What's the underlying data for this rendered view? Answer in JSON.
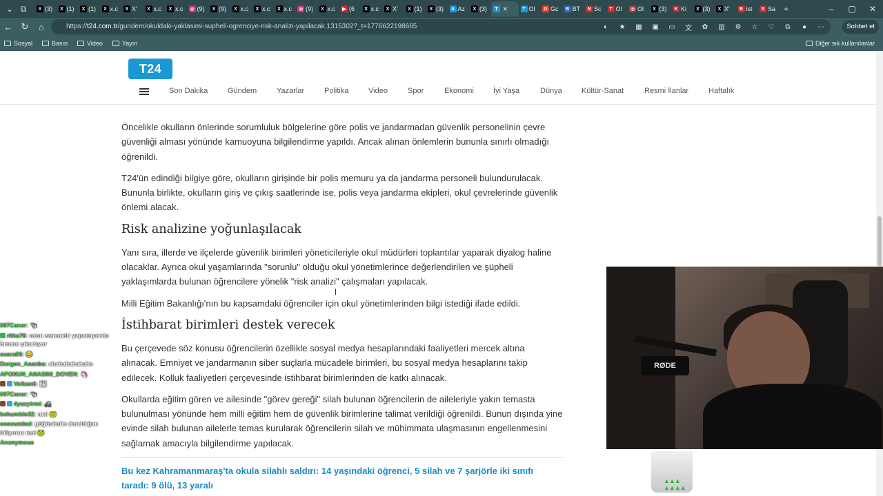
{
  "browser": {
    "tabs": [
      {
        "icon": "X",
        "label": "(3)",
        "color": "#000"
      },
      {
        "icon": "X",
        "label": "(1)",
        "color": "#000"
      },
      {
        "icon": "X",
        "label": "(1)",
        "color": "#000"
      },
      {
        "icon": "X",
        "label": "x.c",
        "color": "#000"
      },
      {
        "icon": "X",
        "label": "X'",
        "color": "#000"
      },
      {
        "icon": "X",
        "label": "x.c",
        "color": "#000"
      },
      {
        "icon": "X",
        "label": "x.c",
        "color": "#000"
      },
      {
        "icon": "◎",
        "label": "(9)",
        "color": "#d62976"
      },
      {
        "icon": "X",
        "label": "(9)",
        "color": "#000"
      },
      {
        "icon": "X",
        "label": "x.c",
        "color": "#000"
      },
      {
        "icon": "X",
        "label": "x.c",
        "color": "#000"
      },
      {
        "icon": "X",
        "label": "x.c",
        "color": "#000"
      },
      {
        "icon": "◎",
        "label": "(9)",
        "color": "#d62976"
      },
      {
        "icon": "X",
        "label": "x.c",
        "color": "#000"
      },
      {
        "icon": "▶",
        "label": "(6",
        "color": "#e02020"
      },
      {
        "icon": "X",
        "label": "x.c",
        "color": "#000"
      },
      {
        "icon": "X",
        "label": "X'",
        "color": "#000"
      },
      {
        "icon": "X",
        "label": "(1)",
        "color": "#000"
      },
      {
        "icon": "X",
        "label": "(3)",
        "color": "#000"
      },
      {
        "icon": "A",
        "label": "Az",
        "color": "#1a98d5"
      },
      {
        "icon": "X",
        "label": "(3)",
        "color": "#000"
      },
      {
        "icon": "T",
        "label": "",
        "color": "#1a98d5",
        "active": true
      },
      {
        "icon": "T",
        "label": "Ol",
        "color": "#1a98d5"
      },
      {
        "icon": "G",
        "label": "Gc",
        "color": "#e04030"
      },
      {
        "icon": "B",
        "label": "BT",
        "color": "#2b6cb0"
      },
      {
        "icon": "N",
        "label": "Sc",
        "color": "#c03030"
      },
      {
        "icon": "T",
        "label": "Ol",
        "color": "#c03030"
      },
      {
        "icon": "◎",
        "label": "Ol",
        "color": "#c03030"
      },
      {
        "icon": "X",
        "label": "(3)",
        "color": "#000"
      },
      {
        "icon": "K",
        "label": "Ki",
        "color": "#b03030"
      },
      {
        "icon": "X",
        "label": "(3)",
        "color": "#000"
      },
      {
        "icon": "X",
        "label": "X'",
        "color": "#000"
      },
      {
        "icon": "B",
        "label": "ist",
        "color": "#c03030"
      },
      {
        "icon": "S",
        "label": "Sa",
        "color": "#c03030"
      }
    ],
    "url_prefix": "https://",
    "url_domain": "t24.com.tr",
    "url_path": "/gundem/okuldaki-yaklasimi-supheli-ogrenciye-risk-analizi-yapilacak,1315302?_t=1776622198665",
    "copilot_label": "Sohbet et",
    "bookmarks": [
      "Sosyal",
      "Basın",
      "Video",
      "Yayın"
    ],
    "bookmarks_other": "Diğer sık kullanılanlar"
  },
  "site": {
    "logo": "T24",
    "nav": [
      "Son Dakika",
      "Gündem",
      "Yazarlar",
      "Politika",
      "Video",
      "Spor",
      "Ekonomi",
      "İyi Yaşa",
      "Dünya",
      "Kültür-Sanat",
      "Resmi İlanlar",
      "Haftalık"
    ]
  },
  "article": {
    "p1": "Öncelikle okulların önlerinde sorumluluk bölgelerine göre polis ve jandarmadan güvenlik personelinin çevre güvenliği alması yönünde kamuoyuna bilgilendirme yapıldı. Ancak alınan önlemlerin bununla sınırlı olmadığı öğrenildi.",
    "p2": "T24'ün edindiği bilgiye göre, okulların girişinde bir polis memuru ya da jandarma personeli bulundurulacak. Bununla birlikte, okulların giriş ve çıkış saatlerinde ise, polis veya jandarma ekipleri, okul çevrelerinde güvenlik önlemi alacak.",
    "h1": "Risk analizine yoğunlaşılacak",
    "p3": "Yanı sıra, illerde ve ilçelerde güvenlik birimleri yöneticileriyle okul müdürleri toplantılar yaparak diyalog haline olacaklar. Ayrıca okul yaşamlarında \"sorunlu\" olduğu okul yönetimlerince değerlendirilen ve şüpheli yaklaşımlarda bulunan öğrencilere yönelik \"risk analizi\" çalışmaları yapılacak.",
    "p4": "Milli Eğitim Bakanlığı'nın bu kapsamdaki öğrenciler için okul yönetimlerinden bilgi istediği ifade edildi.",
    "h2": "İstihbarat birimleri destek verecek",
    "p5": "Bu çerçevede söz konusu öğrencilerin özellikle sosyal medya hesaplarındaki faaliyetleri mercek altına alınacak. Emniyet ve jandarmanın siber suçlarla mücadele birimleri, bu sosyal medya hesaplarını takip edilecek. Kolluk faaliyetleri çerçevesinde istihbarat birimlerinden de katkı alınacak.",
    "p6": "Okullarda eğitim gören ve ailesinde \"görev gereği\" silah bulunan öğrencilerin de aileleriyle yakın temasta bulunulması yönünde hem milli eğitim hem de güvenlik birimlerine talimat verildiği öğrenildi. Bunun dışında yine evinde silah bulunan ailelerle temas kurularak öğrencilerin silah ve mühimmata ulaşmasının engellenmesini sağlamak amacıyla bilgilendirme yapılacak.",
    "related": "Bu kez Kahramanmaraş'ta okula silahlı saldırı: 14 yaşındaki öğrenci, 5 silah ve 7 şarjörle iki sınıfı taradı: 9 ölü, 13 yaralı"
  },
  "chat": [
    {
      "user": "007Caner",
      "msg": "🐄",
      "badges": []
    },
    {
      "user": "ritka76",
      "msg": "uzun zamandır yapamıyordu hıncını çıkartıyor",
      "badges": [
        "#3cb043"
      ]
    },
    {
      "user": "suara06",
      "msg": "😂",
      "badges": []
    },
    {
      "user": "Durgen_Asanba",
      "msg": "ahahahahahaha",
      "badges": []
    },
    {
      "user": "APONUN_ANASINI_DOVEN",
      "msg": "🦄",
      "badges": []
    },
    {
      "user": "Volkan6",
      "msg": "🖼",
      "badges": [
        "#7a4a2a",
        "#3aa0e0"
      ]
    },
    {
      "user": "007Caner",
      "msg": "🐄",
      "badges": []
    },
    {
      "user": "4yuzyirmi",
      "msg": "🚜",
      "badges": [
        "#7a4a2a",
        "#3aa0e0"
      ]
    },
    {
      "user": "behumble32",
      "msg": "mel 🐸",
      "badges": []
    },
    {
      "user": "eosoumbul",
      "msg": "göğüsünün daraldığını biliyoruz mel 🐸",
      "badges": []
    },
    {
      "user": "Anonymous",
      "msg": "",
      "badges": []
    }
  ],
  "colors": {
    "accent": "#1a98d5",
    "chat_user": "#51d551",
    "browser_bg": "#2e4a4f"
  }
}
